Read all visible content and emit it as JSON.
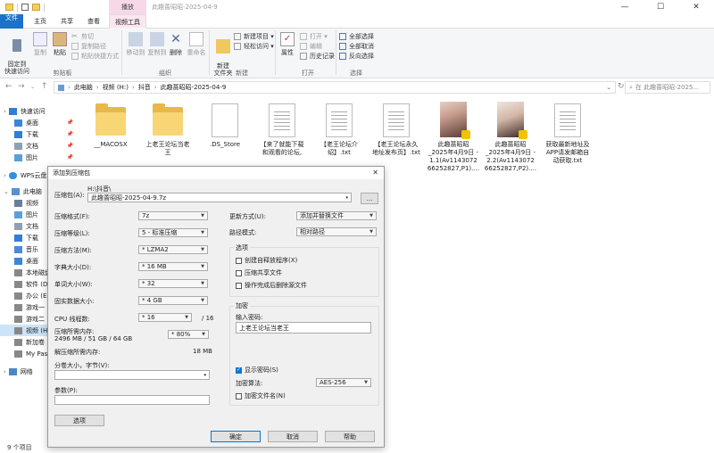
{
  "window": {
    "tool_tab": "播放",
    "title": "此趣蔷昭昭-2025-04-9",
    "minimize": "—",
    "maximize": "☐",
    "close": "✕"
  },
  "ribbon_tabs": [
    "文件",
    "主页",
    "共享",
    "查看",
    "视频工具"
  ],
  "ribbon": {
    "pin": "固定到\n快速访问",
    "copy": "复制",
    "paste": "粘贴",
    "cut": "剪切",
    "copy_path": "复制路径",
    "paste_shortcut": "粘贴快捷方式",
    "group_clipboard": "剪贴板",
    "move_to": "移动到",
    "copy_to": "复制到",
    "delete": "删除",
    "rename": "重命名",
    "group_organize": "组织",
    "new_folder": "新建\n文件夹",
    "new_item": "新建项目 ▾",
    "easy_access": "轻松访问 ▾",
    "group_new": "新建",
    "properties": "属性",
    "open": "打开 ▾",
    "edit": "编辑",
    "history": "历史记录",
    "group_open": "打开",
    "select_all": "全部选择",
    "select_none": "全部取消",
    "invert": "反向选择",
    "group_select": "选择"
  },
  "address": {
    "crumbs": [
      "此电脑",
      "视频 (H:)",
      "抖音",
      "此趣蔷昭昭-2025-04-9"
    ],
    "search_placeholder": "在 此趣蔷昭昭-2025..."
  },
  "nav": {
    "quick_access": "快速访问",
    "desktop": "桌面",
    "downloads": "下载",
    "documents": "文档",
    "pictures": "图片",
    "wps": "WPS云盘",
    "this_pc": "此电脑",
    "videos": "视频",
    "pictures2": "图片",
    "documents2": "文档",
    "downloads2": "下载",
    "music": "音乐",
    "desktop2": "桌面",
    "local_disk": "本地磁盘",
    "soft": "软件 (D:",
    "office": "办公 (E:",
    "games1": "游戏一",
    "games2": "游戏二",
    "video_h": "视频 (H:",
    "new_vol": "新加卷",
    "mypass": "My Pass",
    "network": "网络"
  },
  "files": [
    {
      "name": "__MACOSX",
      "type": "folder"
    },
    {
      "name": "上老王论坛当老\n王",
      "type": "folder"
    },
    {
      "name": ".DS_Store",
      "type": "doc"
    },
    {
      "name": "【来了就能下载\n和观看的论坛,",
      "type": "doc"
    },
    {
      "name": "【老王论坛介\n绍】.txt",
      "type": "doc"
    },
    {
      "name": "【老王论坛永久\n地址发布页】.txt",
      "type": "doc"
    },
    {
      "name": "此趣蔷昭昭\n_2025年4月9日 -\n1.1(Av1143072\n66252827,P1)....",
      "type": "thumb"
    },
    {
      "name": "此趣蔷昭昭\n_2025年4月9日 -\n2.2(Av1143072\n66252827,P2)....",
      "type": "thumb"
    },
    {
      "name": "获取最新地址及\nAPP请发邮箱自\n动获取.txt",
      "type": "doc"
    }
  ],
  "status": {
    "count": "9 个项目"
  },
  "dialog": {
    "title": "添加到压缩包",
    "archive_label": "压缩包(A):",
    "archive_dir": "H:\\抖音\\",
    "archive_name": "此趣蔷昭昭-2025-04-9.7z",
    "browse": "...",
    "format_label": "压缩格式(F):",
    "format": "7z",
    "level_label": "压缩等级(L):",
    "level": "5 - 标准压缩",
    "method_label": "压缩方法(M):",
    "method": "* LZMA2",
    "dict_label": "字典大小(D):",
    "dict": "* 16 MB",
    "word_label": "单词大小(W):",
    "word": "* 32",
    "solid_label": "固实数据大小:",
    "solid": "* 4 GB",
    "threads_label": "CPU 线程数:",
    "threads": "* 16",
    "threads_total": "/ 16",
    "mem_comp_label": "压缩所需内存:",
    "mem_comp_value": "2496 MB / 51 GB / 64 GB",
    "mem_pct": "* 80%",
    "mem_decomp_label": "解压缩所需内存:",
    "mem_decomp_value": "18 MB",
    "split_label": "分卷大小，字节(V):",
    "params_label": "参数(P):",
    "options_btn": "选项",
    "update_label": "更新方式(U):",
    "update": "添加并替换文件",
    "path_label": "路径模式:",
    "path": "相对路径",
    "options_group": "选项",
    "opt_sfx": "创建自释放程序(X)",
    "opt_shared": "压缩共享文件",
    "opt_delete": "操作完成后删除源文件",
    "encrypt_group": "加密",
    "pwd_label": "输入密码:",
    "pwd_value": "上老王论坛当老王",
    "show_pwd": "显示密码(S)",
    "enc_method_label": "加密算法:",
    "enc_method": "AES-256",
    "enc_names": "加密文件名(N)",
    "ok": "确定",
    "cancel": "取消",
    "help": "帮助"
  }
}
